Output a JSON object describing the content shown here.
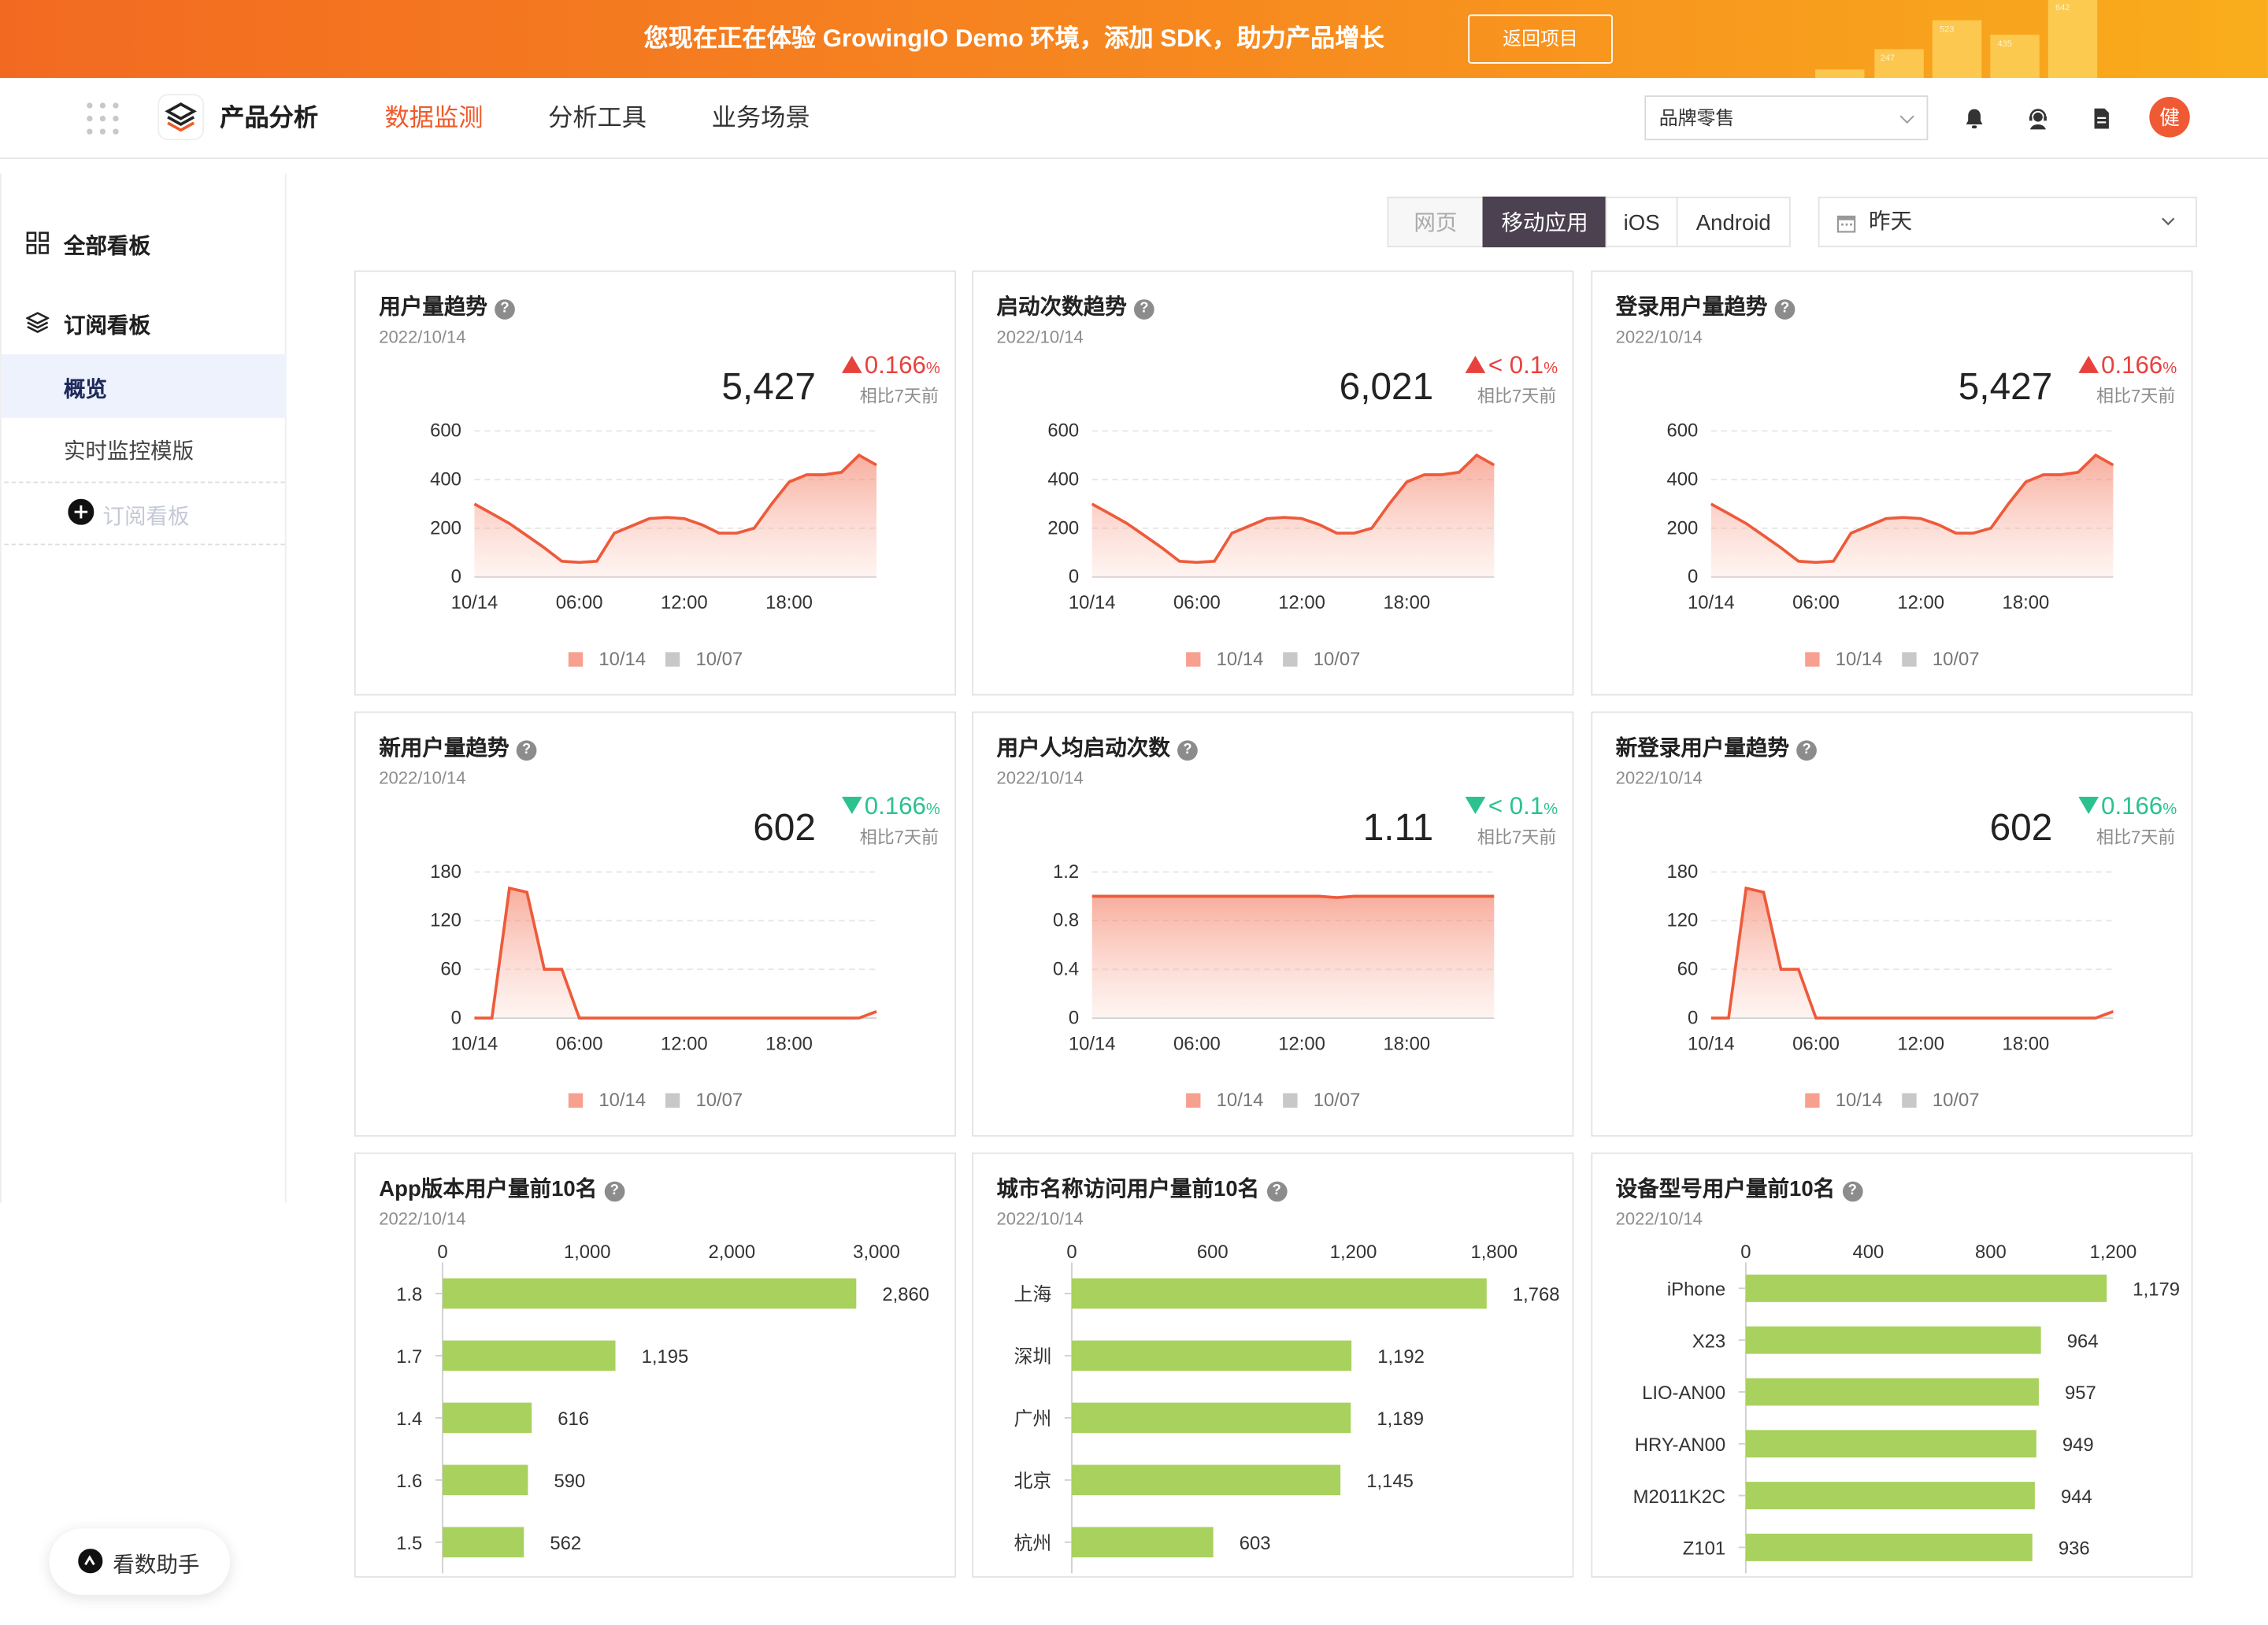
{
  "banner": {
    "text": "您现在正在体验 GrowingIO Demo 环境，添加 SDK，助力产品增长",
    "button": "返回项目",
    "deco_labels": [
      "247",
      "523",
      "435",
      "642"
    ]
  },
  "topnav": {
    "product": "产品分析",
    "menu": [
      "数据监测",
      "分析工具",
      "业务场景"
    ],
    "active_menu": "数据监测",
    "brand_select": "品牌零售",
    "avatar": "健",
    "accent_color": "#f05a28"
  },
  "sidebar": {
    "all_boards": "全部看板",
    "subscribed_boards": "订阅看板",
    "overview": "概览",
    "realtime_template": "实时监控模版",
    "subscribe_board": "订阅看板",
    "assistant": "看数助手"
  },
  "filters": {
    "platforms": [
      "网页",
      "移动应用",
      "iOS",
      "Android"
    ],
    "active_platform": "移动应用",
    "date": "昨天"
  },
  "legend": {
    "current": "10/14",
    "previous": "10/07"
  },
  "trend_cards": [
    {
      "title": "用户量趋势",
      "date": "2022/10/14",
      "value": "5,427",
      "direction": "up",
      "delta": "0.166",
      "delta_unit": "%",
      "compare": "相比7天前",
      "chart_data": {
        "type": "area",
        "x_ticks": [
          "10/14",
          "06:00",
          "12:00",
          "18:00"
        ],
        "y_ticks": [
          "0",
          "200",
          "400",
          "600"
        ],
        "ylim": [
          0,
          600
        ],
        "x": [
          0,
          1,
          2,
          3,
          4,
          5,
          6,
          7,
          8,
          9,
          10,
          11,
          12,
          13,
          14,
          15,
          16,
          17,
          18,
          19,
          20,
          21,
          22,
          23
        ],
        "series": [
          {
            "name": "10/14",
            "values": [
              300,
              260,
              220,
              170,
              120,
              65,
              60,
              65,
              180,
              210,
              240,
              245,
              240,
              215,
              180,
              180,
              200,
              300,
              390,
              420,
              420,
              430,
              500,
              460
            ]
          },
          {
            "name": "10/07",
            "values": []
          }
        ]
      }
    },
    {
      "title": "启动次数趋势",
      "date": "2022/10/14",
      "value": "6,021",
      "direction": "up",
      "delta": "< 0.1",
      "delta_unit": "%",
      "compare": "相比7天前",
      "chart_data": {
        "type": "area",
        "x_ticks": [
          "10/14",
          "06:00",
          "12:00",
          "18:00"
        ],
        "y_ticks": [
          "0",
          "200",
          "400",
          "600"
        ],
        "ylim": [
          0,
          600
        ],
        "x": [
          0,
          1,
          2,
          3,
          4,
          5,
          6,
          7,
          8,
          9,
          10,
          11,
          12,
          13,
          14,
          15,
          16,
          17,
          18,
          19,
          20,
          21,
          22,
          23
        ],
        "series": [
          {
            "name": "10/14",
            "values": [
              300,
              260,
              220,
              170,
              120,
              65,
              60,
              65,
              180,
              210,
              240,
              245,
              240,
              215,
              180,
              180,
              200,
              300,
              390,
              420,
              420,
              430,
              500,
              460
            ]
          },
          {
            "name": "10/07",
            "values": []
          }
        ]
      }
    },
    {
      "title": "登录用户量趋势",
      "date": "2022/10/14",
      "value": "5,427",
      "direction": "up",
      "delta": "0.166",
      "delta_unit": "%",
      "compare": "相比7天前",
      "chart_data": {
        "type": "area",
        "x_ticks": [
          "10/14",
          "06:00",
          "12:00",
          "18:00"
        ],
        "y_ticks": [
          "0",
          "200",
          "400",
          "600"
        ],
        "ylim": [
          0,
          600
        ],
        "x": [
          0,
          1,
          2,
          3,
          4,
          5,
          6,
          7,
          8,
          9,
          10,
          11,
          12,
          13,
          14,
          15,
          16,
          17,
          18,
          19,
          20,
          21,
          22,
          23
        ],
        "series": [
          {
            "name": "10/14",
            "values": [
              300,
              260,
              220,
              170,
              120,
              65,
              60,
              65,
              180,
              210,
              240,
              245,
              240,
              215,
              180,
              180,
              200,
              300,
              390,
              420,
              420,
              430,
              500,
              460
            ]
          },
          {
            "name": "10/07",
            "values": []
          }
        ]
      }
    },
    {
      "title": "新用户量趋势",
      "date": "2022/10/14",
      "value": "602",
      "direction": "down",
      "delta": "0.166",
      "delta_unit": "%",
      "compare": "相比7天前",
      "chart_data": {
        "type": "area",
        "x_ticks": [
          "10/14",
          "06:00",
          "12:00",
          "18:00"
        ],
        "y_ticks": [
          "0",
          "60",
          "120",
          "180"
        ],
        "ylim": [
          0,
          180
        ],
        "x": [
          0,
          1,
          2,
          3,
          4,
          5,
          6,
          7,
          8,
          9,
          10,
          11,
          12,
          13,
          14,
          15,
          16,
          17,
          18,
          19,
          20,
          21,
          22,
          23
        ],
        "series": [
          {
            "name": "10/14",
            "values": [
              0,
              0,
              160,
              155,
              60,
              60,
              0,
              0,
              0,
              0,
              0,
              0,
              0,
              0,
              0,
              0,
              0,
              0,
              0,
              0,
              0,
              0,
              0,
              8
            ]
          },
          {
            "name": "10/07",
            "values": []
          }
        ]
      }
    },
    {
      "title": "用户人均启动次数",
      "date": "2022/10/14",
      "value": "1.11",
      "direction": "down",
      "delta": "< 0.1",
      "delta_unit": "%",
      "compare": "相比7天前",
      "chart_data": {
        "type": "area",
        "x_ticks": [
          "10/14",
          "06:00",
          "12:00",
          "18:00"
        ],
        "y_ticks": [
          "0",
          "0.4",
          "0.8",
          "1.2"
        ],
        "ylim": [
          0,
          1.2
        ],
        "x": [
          0,
          1,
          2,
          3,
          4,
          5,
          6,
          7,
          8,
          9,
          10,
          11,
          12,
          13,
          14,
          15,
          16,
          17,
          18,
          19,
          20,
          21,
          22,
          23
        ],
        "series": [
          {
            "name": "10/14",
            "values": [
              1.0,
              1.0,
              1.0,
              1.0,
              1.0,
              1.0,
              1.0,
              1.0,
              1.0,
              1.0,
              1.0,
              1.0,
              1.0,
              1.0,
              0.99,
              1.0,
              1.0,
              1.0,
              1.0,
              1.0,
              1.0,
              1.0,
              1.0,
              1.0
            ]
          },
          {
            "name": "10/07",
            "values": []
          }
        ]
      }
    },
    {
      "title": "新登录用户量趋势",
      "date": "2022/10/14",
      "value": "602",
      "direction": "down",
      "delta": "0.166",
      "delta_unit": "%",
      "compare": "相比7天前",
      "chart_data": {
        "type": "area",
        "x_ticks": [
          "10/14",
          "06:00",
          "12:00",
          "18:00"
        ],
        "y_ticks": [
          "0",
          "60",
          "120",
          "180"
        ],
        "ylim": [
          0,
          180
        ],
        "x": [
          0,
          1,
          2,
          3,
          4,
          5,
          6,
          7,
          8,
          9,
          10,
          11,
          12,
          13,
          14,
          15,
          16,
          17,
          18,
          19,
          20,
          21,
          22,
          23
        ],
        "series": [
          {
            "name": "10/14",
            "values": [
              0,
              0,
              160,
              155,
              60,
              60,
              0,
              0,
              0,
              0,
              0,
              0,
              0,
              0,
              0,
              0,
              0,
              0,
              0,
              0,
              0,
              0,
              0,
              8
            ]
          },
          {
            "name": "10/07",
            "values": []
          }
        ]
      }
    }
  ],
  "bar_cards": [
    {
      "title": "App版本用户量前10名",
      "date": "2022/10/14",
      "chart_data": {
        "type": "bar",
        "x_ticks": [
          "0",
          "1,000",
          "2,000",
          "3,000"
        ],
        "xlim": [
          0,
          3000
        ],
        "categories": [
          "1.8",
          "1.7",
          "1.4",
          "1.6",
          "1.5"
        ],
        "values": [
          2860,
          1195,
          616,
          590,
          562
        ],
        "labels": [
          "2,860",
          "1,195",
          "616",
          "590",
          "562"
        ]
      }
    },
    {
      "title": "城市名称访问用户量前10名",
      "date": "2022/10/14",
      "chart_data": {
        "type": "bar",
        "x_ticks": [
          "0",
          "600",
          "1,200",
          "1,800"
        ],
        "xlim": [
          0,
          1800
        ],
        "categories": [
          "上海",
          "深圳",
          "广州",
          "北京",
          "杭州"
        ],
        "values": [
          1768,
          1192,
          1189,
          1145,
          603
        ],
        "labels": [
          "1,768",
          "1,192",
          "1,189",
          "1,145",
          "603"
        ]
      }
    },
    {
      "title": "设备型号用户量前10名",
      "date": "2022/10/14",
      "chart_data": {
        "type": "bar",
        "x_ticks": [
          "0",
          "400",
          "800",
          "1,200"
        ],
        "xlim": [
          0,
          1200
        ],
        "categories": [
          "iPhone",
          "X23",
          "LIO-AN00",
          "HRY-AN00",
          "M2011K2C",
          "Z101"
        ],
        "values": [
          1179,
          964,
          957,
          949,
          944,
          936
        ],
        "labels": [
          "1,179",
          "964",
          "957",
          "949",
          "944",
          "936"
        ]
      }
    }
  ],
  "colors": {
    "line": "#ee5a3a",
    "bar": "#a9d15d",
    "up": "#e8413d",
    "down": "#2bc28f",
    "legend_current": "#f7a08f",
    "legend_previous": "#c8c8c8"
  }
}
